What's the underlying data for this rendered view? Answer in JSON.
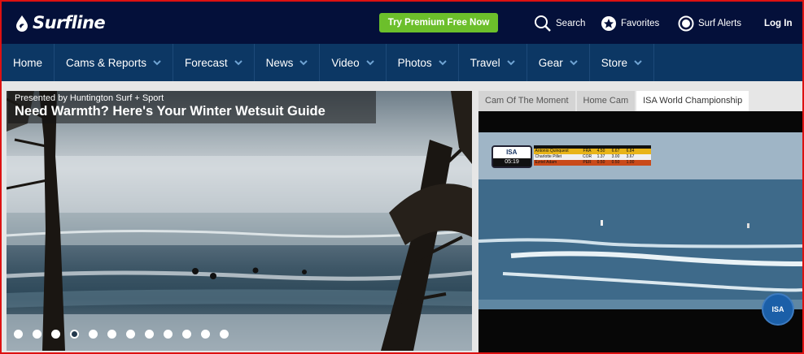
{
  "brand": {
    "name": "Surfline",
    "logo_icon": "surfline-drop-icon"
  },
  "header": {
    "premium_cta": "Try Premium Free Now",
    "search": {
      "label": "Search",
      "icon": "search-icon"
    },
    "favorites": {
      "label": "Favorites",
      "icon": "star-icon"
    },
    "alerts": {
      "label": "Surf Alerts",
      "icon": "radio-icon"
    },
    "login": "Log In"
  },
  "nav": {
    "items": [
      {
        "label": "Home",
        "has_dropdown": false
      },
      {
        "label": "Cams & Reports",
        "has_dropdown": true
      },
      {
        "label": "Forecast",
        "has_dropdown": true
      },
      {
        "label": "News",
        "has_dropdown": true
      },
      {
        "label": "Video",
        "has_dropdown": true
      },
      {
        "label": "Photos",
        "has_dropdown": true
      },
      {
        "label": "Travel",
        "has_dropdown": true
      },
      {
        "label": "Gear",
        "has_dropdown": true
      },
      {
        "label": "Store",
        "has_dropdown": true
      }
    ]
  },
  "hero": {
    "presented_by": "Presented by Huntington Surf + Sport",
    "title": "Need Warmth? Here's Your Winter Wetsuit Guide",
    "slides_total": 12,
    "active_slide": 4
  },
  "cams": {
    "tabs": [
      {
        "label": "Cam Of The Moment",
        "active": false
      },
      {
        "label": "Home Cam",
        "active": false
      },
      {
        "label": "ISA World Championship",
        "active": true
      }
    ],
    "scoreboard": {
      "org": "ISA",
      "timer": "05:19",
      "rows": [
        {
          "name": "Antonio Quinquest",
          "country": "FRA",
          "s1": "4.50",
          "s2": "6.67",
          "total": "6.84"
        },
        {
          "name": "Charlotte Pillet",
          "country": "COR",
          "s1": "1.37",
          "s2": "3.00",
          "total": "3.67"
        },
        {
          "name": "Ezriel Adam",
          "country": "PER",
          "s1": "0.50",
          "s2": "0.50",
          "total": "1.00"
        }
      ]
    },
    "watermark": "ISA"
  },
  "colors": {
    "topbar": "#04103a",
    "nav": "#0c3764",
    "premium": "#6cbf2b",
    "accent_row": "#e8b418"
  }
}
